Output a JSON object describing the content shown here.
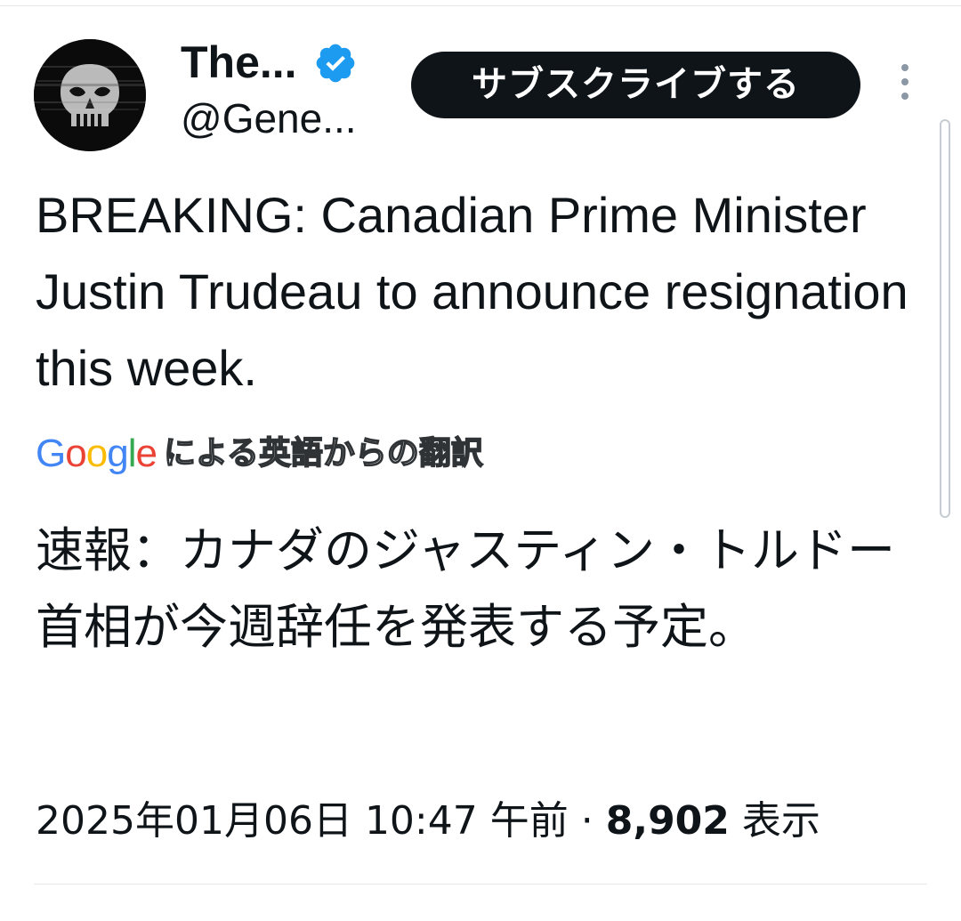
{
  "header": {
    "display_name": "The...",
    "handle": "@Gene...",
    "verified": true,
    "verified_color": "#1d9bf0",
    "subscribe_label": "サブスクライブする",
    "more_icon": "more-vertical-icon"
  },
  "tweet": {
    "text": "BREAKING: Canadian Prime Minister Justin Trudeau to announce resignation this week.",
    "translation_provider": "Google",
    "translation_label": "による英語からの翻訳",
    "translated_text": "速報：カナダのジャスティン・トルドー首相が今週辞任を発表する予定。"
  },
  "meta": {
    "timestamp": "2025年01月06日 10:47 午前",
    "separator": "·",
    "views_count": "8,902",
    "views_label": "表示"
  },
  "colors": {
    "text": "#0f1419",
    "button_bg": "#0f1419",
    "divider": "#e6e9eb"
  }
}
